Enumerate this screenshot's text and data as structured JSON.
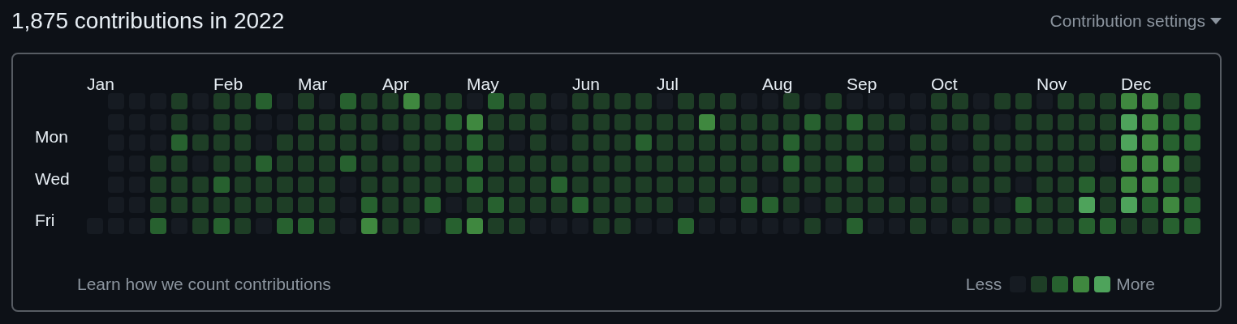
{
  "title": "1,875 contributions in 2022",
  "settings": {
    "label": "Contribution settings"
  },
  "day_labels": [
    "Mon",
    "Wed",
    "Fri"
  ],
  "weeks": [
    {
      "month": "Jan",
      "days": [
        {
          "color": "#161b22"
        }
      ]
    },
    {
      "days": [
        {
          "color": "#161b22"
        },
        {
          "color": "#161b22"
        },
        {
          "color": "#161b22"
        },
        {
          "color": "#161b22"
        },
        {
          "color": "#161b22"
        },
        {
          "color": "#161b22"
        },
        {
          "color": "#161b22"
        }
      ]
    },
    {
      "days": [
        {
          "color": "#161b22"
        },
        {
          "color": "#161b22"
        },
        {
          "color": "#161b22"
        },
        {
          "color": "#161b22"
        },
        {
          "color": "#161b22"
        },
        {
          "color": "#161b22"
        },
        {
          "color": "#161b22"
        }
      ]
    },
    {
      "days": [
        {
          "color": "#161b22"
        },
        {
          "color": "#161b22"
        },
        {
          "color": "#161b22"
        },
        {
          "color": "#1e3e26"
        },
        {
          "color": "#1e3e26"
        },
        {
          "color": "#1e3e26"
        },
        {
          "color": "#27612f"
        }
      ]
    },
    {
      "days": [
        {
          "color": "#1e3e26"
        },
        {
          "color": "#1e3e26"
        },
        {
          "color": "#27612f"
        },
        {
          "color": "#1e3e26"
        },
        {
          "color": "#1e3e26"
        },
        {
          "color": "#1e3e26"
        },
        {
          "color": "#161b22"
        }
      ]
    },
    {
      "days": [
        {
          "color": "#161b22"
        },
        {
          "color": "#161b22"
        },
        {
          "color": "#1e3e26"
        },
        {
          "color": "#161b22"
        },
        {
          "color": "#1e3e26"
        },
        {
          "color": "#1e3e26"
        },
        {
          "color": "#1e3e26"
        }
      ]
    },
    {
      "month": "Feb",
      "days": [
        {
          "color": "#1e3e26"
        },
        {
          "color": "#1e3e26"
        },
        {
          "color": "#1e3e26"
        },
        {
          "color": "#1e3e26"
        },
        {
          "color": "#27612f"
        },
        {
          "color": "#1e3e26"
        },
        {
          "color": "#27612f"
        }
      ]
    },
    {
      "days": [
        {
          "color": "#1e3e26"
        },
        {
          "color": "#1e3e26"
        },
        {
          "color": "#1e3e26"
        },
        {
          "color": "#1e3e26"
        },
        {
          "color": "#1e3e26"
        },
        {
          "color": "#1e3e26"
        },
        {
          "color": "#1e3e26"
        }
      ]
    },
    {
      "days": [
        {
          "color": "#27612f"
        },
        {
          "color": "#161b22"
        },
        {
          "color": "#161b22"
        },
        {
          "color": "#27612f"
        },
        {
          "color": "#1e3e26"
        },
        {
          "color": "#1e3e26"
        },
        {
          "color": "#161b22"
        }
      ]
    },
    {
      "days": [
        {
          "color": "#161b22"
        },
        {
          "color": "#161b22"
        },
        {
          "color": "#1e3e26"
        },
        {
          "color": "#1e3e26"
        },
        {
          "color": "#1e3e26"
        },
        {
          "color": "#1e3e26"
        },
        {
          "color": "#27612f"
        }
      ]
    },
    {
      "month": "Mar",
      "days": [
        {
          "color": "#1e3e26"
        },
        {
          "color": "#1e3e26"
        },
        {
          "color": "#1e3e26"
        },
        {
          "color": "#1e3e26"
        },
        {
          "color": "#1e3e26"
        },
        {
          "color": "#1e3e26"
        },
        {
          "color": "#27612f"
        }
      ]
    },
    {
      "days": [
        {
          "color": "#161b22"
        },
        {
          "color": "#1e3e26"
        },
        {
          "color": "#1e3e26"
        },
        {
          "color": "#1e3e26"
        },
        {
          "color": "#1e3e26"
        },
        {
          "color": "#1e3e26"
        },
        {
          "color": "#1e3e26"
        }
      ]
    },
    {
      "days": [
        {
          "color": "#27612f"
        },
        {
          "color": "#1e3e26"
        },
        {
          "color": "#1e3e26"
        },
        {
          "color": "#27612f"
        },
        {
          "color": "#161b22"
        },
        {
          "color": "#161b22"
        },
        {
          "color": "#161b22"
        }
      ]
    },
    {
      "days": [
        {
          "color": "#1e3e26"
        },
        {
          "color": "#1e3e26"
        },
        {
          "color": "#1e3e26"
        },
        {
          "color": "#1e3e26"
        },
        {
          "color": "#1e3e26"
        },
        {
          "color": "#27612f"
        },
        {
          "color": "#3f883f"
        }
      ]
    },
    {
      "month": "Apr",
      "days": [
        {
          "color": "#1e3e26"
        },
        {
          "color": "#1e3e26"
        },
        {
          "color": "#161b22"
        },
        {
          "color": "#1e3e26"
        },
        {
          "color": "#1e3e26"
        },
        {
          "color": "#1e3e26"
        },
        {
          "color": "#1e3e26"
        }
      ]
    },
    {
      "days": [
        {
          "color": "#3f883f"
        },
        {
          "color": "#1e3e26"
        },
        {
          "color": "#1e3e26"
        },
        {
          "color": "#1e3e26"
        },
        {
          "color": "#1e3e26"
        },
        {
          "color": "#1e3e26"
        },
        {
          "color": "#1e3e26"
        }
      ]
    },
    {
      "days": [
        {
          "color": "#1e3e26"
        },
        {
          "color": "#1e3e26"
        },
        {
          "color": "#1e3e26"
        },
        {
          "color": "#1e3e26"
        },
        {
          "color": "#1e3e26"
        },
        {
          "color": "#27612f"
        },
        {
          "color": "#161b22"
        }
      ]
    },
    {
      "days": [
        {
          "color": "#1e3e26"
        },
        {
          "color": "#27612f"
        },
        {
          "color": "#1e3e26"
        },
        {
          "color": "#1e3e26"
        },
        {
          "color": "#1e3e26"
        },
        {
          "color": "#161b22"
        },
        {
          "color": "#27612f"
        }
      ]
    },
    {
      "month": "May",
      "days": [
        {
          "color": "#161b22"
        },
        {
          "color": "#3f883f"
        },
        {
          "color": "#27612f"
        },
        {
          "color": "#27612f"
        },
        {
          "color": "#27612f"
        },
        {
          "color": "#1e3e26"
        },
        {
          "color": "#3f883f"
        }
      ]
    },
    {
      "days": [
        {
          "color": "#27612f"
        },
        {
          "color": "#1e3e26"
        },
        {
          "color": "#1e3e26"
        },
        {
          "color": "#1e3e26"
        },
        {
          "color": "#1e3e26"
        },
        {
          "color": "#27612f"
        },
        {
          "color": "#1e3e26"
        }
      ]
    },
    {
      "days": [
        {
          "color": "#1e3e26"
        },
        {
          "color": "#1e3e26"
        },
        {
          "color": "#161b22"
        },
        {
          "color": "#1e3e26"
        },
        {
          "color": "#1e3e26"
        },
        {
          "color": "#1e3e26"
        },
        {
          "color": "#1e3e26"
        }
      ]
    },
    {
      "days": [
        {
          "color": "#1e3e26"
        },
        {
          "color": "#1e3e26"
        },
        {
          "color": "#1e3e26"
        },
        {
          "color": "#1e3e26"
        },
        {
          "color": "#1e3e26"
        },
        {
          "color": "#1e3e26"
        },
        {
          "color": "#161b22"
        }
      ]
    },
    {
      "days": [
        {
          "color": "#161b22"
        },
        {
          "color": "#161b22"
        },
        {
          "color": "#161b22"
        },
        {
          "color": "#1e3e26"
        },
        {
          "color": "#27612f"
        },
        {
          "color": "#1e3e26"
        },
        {
          "color": "#161b22"
        }
      ]
    },
    {
      "month": "Jun",
      "days": [
        {
          "color": "#1e3e26"
        },
        {
          "color": "#1e3e26"
        },
        {
          "color": "#1e3e26"
        },
        {
          "color": "#1e3e26"
        },
        {
          "color": "#1e3e26"
        },
        {
          "color": "#27612f"
        },
        {
          "color": "#161b22"
        }
      ]
    },
    {
      "days": [
        {
          "color": "#1e3e26"
        },
        {
          "color": "#1e3e26"
        },
        {
          "color": "#1e3e26"
        },
        {
          "color": "#1e3e26"
        },
        {
          "color": "#1e3e26"
        },
        {
          "color": "#1e3e26"
        },
        {
          "color": "#1e3e26"
        }
      ]
    },
    {
      "days": [
        {
          "color": "#1e3e26"
        },
        {
          "color": "#1e3e26"
        },
        {
          "color": "#1e3e26"
        },
        {
          "color": "#1e3e26"
        },
        {
          "color": "#1e3e26"
        },
        {
          "color": "#1e3e26"
        },
        {
          "color": "#1e3e26"
        }
      ]
    },
    {
      "days": [
        {
          "color": "#1e3e26"
        },
        {
          "color": "#1e3e26"
        },
        {
          "color": "#27612f"
        },
        {
          "color": "#1e3e26"
        },
        {
          "color": "#1e3e26"
        },
        {
          "color": "#1e3e26"
        },
        {
          "color": "#161b22"
        }
      ]
    },
    {
      "month": "Jul",
      "days": [
        {
          "color": "#161b22"
        },
        {
          "color": "#1e3e26"
        },
        {
          "color": "#1e3e26"
        },
        {
          "color": "#1e3e26"
        },
        {
          "color": "#1e3e26"
        },
        {
          "color": "#1e3e26"
        },
        {
          "color": "#161b22"
        }
      ]
    },
    {
      "days": [
        {
          "color": "#1e3e26"
        },
        {
          "color": "#1e3e26"
        },
        {
          "color": "#1e3e26"
        },
        {
          "color": "#1e3e26"
        },
        {
          "color": "#1e3e26"
        },
        {
          "color": "#161b22"
        },
        {
          "color": "#27612f"
        }
      ]
    },
    {
      "days": [
        {
          "color": "#1e3e26"
        },
        {
          "color": "#3f883f"
        },
        {
          "color": "#1e3e26"
        },
        {
          "color": "#1e3e26"
        },
        {
          "color": "#1e3e26"
        },
        {
          "color": "#1e3e26"
        },
        {
          "color": "#161b22"
        }
      ]
    },
    {
      "days": [
        {
          "color": "#1e3e26"
        },
        {
          "color": "#1e3e26"
        },
        {
          "color": "#1e3e26"
        },
        {
          "color": "#1e3e26"
        },
        {
          "color": "#1e3e26"
        },
        {
          "color": "#161b22"
        },
        {
          "color": "#161b22"
        }
      ]
    },
    {
      "days": [
        {
          "color": "#161b22"
        },
        {
          "color": "#1e3e26"
        },
        {
          "color": "#1e3e26"
        },
        {
          "color": "#1e3e26"
        },
        {
          "color": "#1e3e26"
        },
        {
          "color": "#27612f"
        },
        {
          "color": "#161b22"
        }
      ]
    },
    {
      "month": "Aug",
      "days": [
        {
          "color": "#161b22"
        },
        {
          "color": "#1e3e26"
        },
        {
          "color": "#1e3e26"
        },
        {
          "color": "#1e3e26"
        },
        {
          "color": "#161b22"
        },
        {
          "color": "#27612f"
        },
        {
          "color": "#161b22"
        }
      ]
    },
    {
      "days": [
        {
          "color": "#1e3e26"
        },
        {
          "color": "#1e3e26"
        },
        {
          "color": "#27612f"
        },
        {
          "color": "#27612f"
        },
        {
          "color": "#1e3e26"
        },
        {
          "color": "#1e3e26"
        },
        {
          "color": "#161b22"
        }
      ]
    },
    {
      "days": [
        {
          "color": "#161b22"
        },
        {
          "color": "#27612f"
        },
        {
          "color": "#1e3e26"
        },
        {
          "color": "#1e3e26"
        },
        {
          "color": "#1e3e26"
        },
        {
          "color": "#161b22"
        },
        {
          "color": "#1e3e26"
        }
      ]
    },
    {
      "days": [
        {
          "color": "#1e3e26"
        },
        {
          "color": "#1e3e26"
        },
        {
          "color": "#1e3e26"
        },
        {
          "color": "#1e3e26"
        },
        {
          "color": "#1e3e26"
        },
        {
          "color": "#1e3e26"
        },
        {
          "color": "#161b22"
        }
      ]
    },
    {
      "month": "Sep",
      "days": [
        {
          "color": "#161b22"
        },
        {
          "color": "#27612f"
        },
        {
          "color": "#1e3e26"
        },
        {
          "color": "#27612f"
        },
        {
          "color": "#1e3e26"
        },
        {
          "color": "#1e3e26"
        },
        {
          "color": "#27612f"
        }
      ]
    },
    {
      "days": [
        {
          "color": "#161b22"
        },
        {
          "color": "#1e3e26"
        },
        {
          "color": "#1e3e26"
        },
        {
          "color": "#1e3e26"
        },
        {
          "color": "#1e3e26"
        },
        {
          "color": "#1e3e26"
        },
        {
          "color": "#161b22"
        }
      ]
    },
    {
      "days": [
        {
          "color": "#161b22"
        },
        {
          "color": "#1e3e26"
        },
        {
          "color": "#161b22"
        },
        {
          "color": "#161b22"
        },
        {
          "color": "#161b22"
        },
        {
          "color": "#1e3e26"
        },
        {
          "color": "#161b22"
        }
      ]
    },
    {
      "days": [
        {
          "color": "#161b22"
        },
        {
          "color": "#161b22"
        },
        {
          "color": "#1e3e26"
        },
        {
          "color": "#1e3e26"
        },
        {
          "color": "#161b22"
        },
        {
          "color": "#1e3e26"
        },
        {
          "color": "#1e3e26"
        }
      ]
    },
    {
      "month": "Oct",
      "days": [
        {
          "color": "#1e3e26"
        },
        {
          "color": "#1e3e26"
        },
        {
          "color": "#1e3e26"
        },
        {
          "color": "#1e3e26"
        },
        {
          "color": "#1e3e26"
        },
        {
          "color": "#1e3e26"
        },
        {
          "color": "#161b22"
        }
      ]
    },
    {
      "days": [
        {
          "color": "#1e3e26"
        },
        {
          "color": "#1e3e26"
        },
        {
          "color": "#161b22"
        },
        {
          "color": "#161b22"
        },
        {
          "color": "#1e3e26"
        },
        {
          "color": "#161b22"
        },
        {
          "color": "#1e3e26"
        }
      ]
    },
    {
      "days": [
        {
          "color": "#161b22"
        },
        {
          "color": "#1e3e26"
        },
        {
          "color": "#1e3e26"
        },
        {
          "color": "#1e3e26"
        },
        {
          "color": "#1e3e26"
        },
        {
          "color": "#1e3e26"
        },
        {
          "color": "#1e3e26"
        }
      ]
    },
    {
      "days": [
        {
          "color": "#1e3e26"
        },
        {
          "color": "#161b22"
        },
        {
          "color": "#1e3e26"
        },
        {
          "color": "#1e3e26"
        },
        {
          "color": "#1e3e26"
        },
        {
          "color": "#161b22"
        },
        {
          "color": "#1e3e26"
        }
      ]
    },
    {
      "days": [
        {
          "color": "#1e3e26"
        },
        {
          "color": "#1e3e26"
        },
        {
          "color": "#1e3e26"
        },
        {
          "color": "#1e3e26"
        },
        {
          "color": "#161b22"
        },
        {
          "color": "#27612f"
        },
        {
          "color": "#1e3e26"
        }
      ]
    },
    {
      "month": "Nov",
      "days": [
        {
          "color": "#161b22"
        },
        {
          "color": "#1e3e26"
        },
        {
          "color": "#1e3e26"
        },
        {
          "color": "#1e3e26"
        },
        {
          "color": "#1e3e26"
        },
        {
          "color": "#1e3e26"
        },
        {
          "color": "#1e3e26"
        }
      ]
    },
    {
      "days": [
        {
          "color": "#1e3e26"
        },
        {
          "color": "#1e3e26"
        },
        {
          "color": "#1e3e26"
        },
        {
          "color": "#1e3e26"
        },
        {
          "color": "#1e3e26"
        },
        {
          "color": "#1e3e26"
        },
        {
          "color": "#1e3e26"
        }
      ]
    },
    {
      "days": [
        {
          "color": "#1e3e26"
        },
        {
          "color": "#1e3e26"
        },
        {
          "color": "#1e3e26"
        },
        {
          "color": "#1e3e26"
        },
        {
          "color": "#27612f"
        },
        {
          "color": "#4ea35b"
        },
        {
          "color": "#27612f"
        }
      ]
    },
    {
      "days": [
        {
          "color": "#1e3e26"
        },
        {
          "color": "#1e3e26"
        },
        {
          "color": "#1e3e26"
        },
        {
          "color": "#161b22"
        },
        {
          "color": "#1e3e26"
        },
        {
          "color": "#1e3e26"
        },
        {
          "color": "#27612f"
        }
      ]
    },
    {
      "month": "Dec",
      "days": [
        {
          "color": "#3f883f"
        },
        {
          "color": "#4ea35b"
        },
        {
          "color": "#4ea35b"
        },
        {
          "color": "#3f883f"
        },
        {
          "color": "#3f883f"
        },
        {
          "color": "#4ea35b"
        },
        {
          "color": "#1e3e26"
        }
      ]
    },
    {
      "days": [
        {
          "color": "#3f883f"
        },
        {
          "color": "#3f883f"
        },
        {
          "color": "#3f883f"
        },
        {
          "color": "#3f883f"
        },
        {
          "color": "#3f883f"
        },
        {
          "color": "#27612f"
        },
        {
          "color": "#1e3e26"
        }
      ]
    },
    {
      "days": [
        {
          "color": "#1e3e26"
        },
        {
          "color": "#27612f"
        },
        {
          "color": "#27612f"
        },
        {
          "color": "#3f883f"
        },
        {
          "color": "#27612f"
        },
        {
          "color": "#3f883f"
        },
        {
          "color": "#27612f"
        }
      ]
    },
    {
      "days": [
        {
          "color": "#27612f"
        },
        {
          "color": "#27612f"
        },
        {
          "color": "#27612f"
        },
        {
          "color": "#1e3e26"
        },
        {
          "color": "#1e3e26"
        },
        {
          "color": "#27612f"
        },
        {
          "color": "#27612f"
        }
      ]
    }
  ],
  "footer_link": "Learn how we count contributions",
  "legend": {
    "less": "Less",
    "more": "More",
    "swatches": [
      {
        "color": "#161b22"
      },
      {
        "color": "#1e3e26"
      },
      {
        "color": "#27612f"
      },
      {
        "color": "#3f883f"
      },
      {
        "color": "#4ea35b"
      }
    ]
  }
}
